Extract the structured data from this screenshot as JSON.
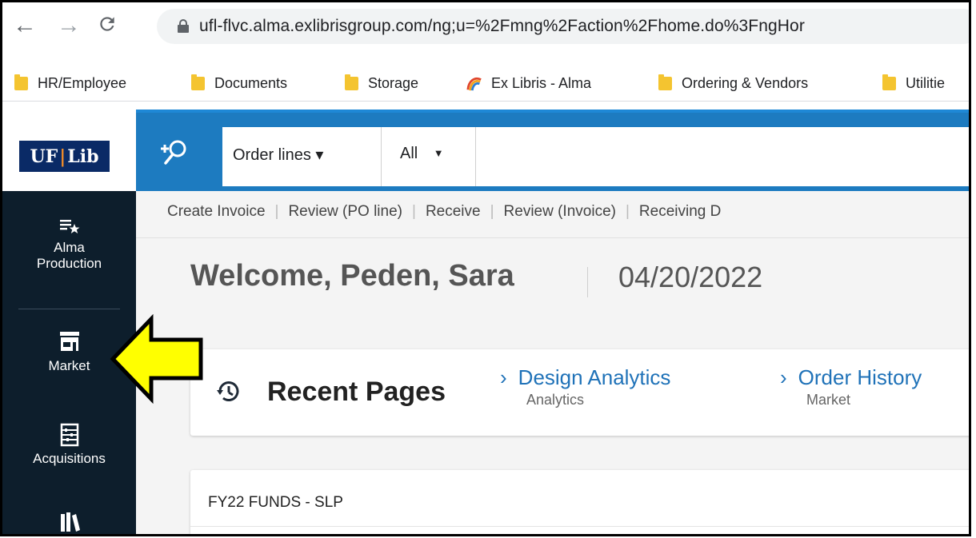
{
  "browser": {
    "url": "ufl-flvc.alma.exlibrisgroup.com/ng;u=%2Fmng%2Faction%2Fhome.do%3FngHor",
    "bookmarks": [
      {
        "label": "HR/Employee",
        "icon": "folder-icon"
      },
      {
        "label": "Documents",
        "icon": "folder-icon"
      },
      {
        "label": "Storage",
        "icon": "folder-icon"
      },
      {
        "label": "Ex Libris - Alma",
        "icon": "exlibris-logo-icon"
      },
      {
        "label": "Ordering & Vendors",
        "icon": "folder-icon"
      },
      {
        "label": "Utilitie",
        "icon": "folder-icon"
      }
    ]
  },
  "logo": {
    "left": "UF",
    "right": "Lib"
  },
  "search": {
    "type_label": "Order lines ▾",
    "scope_label": "All",
    "value": ""
  },
  "sidebar": {
    "items": [
      {
        "label_line1": "Alma",
        "label_line2": "Production",
        "icon": "list-star-icon"
      },
      {
        "label_line1": "Market",
        "label_line2": "",
        "icon": "store-icon"
      },
      {
        "label_line1": "Acquisitions",
        "label_line2": "",
        "icon": "abacus-icon"
      },
      {
        "label_line1": "",
        "label_line2": "",
        "icon": "books-icon"
      }
    ]
  },
  "toolbar": {
    "links": [
      "Create Invoice",
      "Review (PO line)",
      "Receive",
      "Review (Invoice)",
      "Receiving D"
    ]
  },
  "welcome": {
    "text": "Welcome, Peden, Sara",
    "date": "04/20/2022"
  },
  "recent": {
    "title": "Recent Pages",
    "links": [
      {
        "label": "Design Analytics",
        "sub": "Analytics"
      },
      {
        "label": "Order History",
        "sub": "Market"
      }
    ]
  },
  "funds": {
    "title": "FY22 FUNDS - SLP"
  },
  "colors": {
    "brand_blue": "#1d7bc0",
    "sidebar": "#0d1e2c",
    "link": "#1f72b8",
    "annotation": "#ffff00"
  }
}
